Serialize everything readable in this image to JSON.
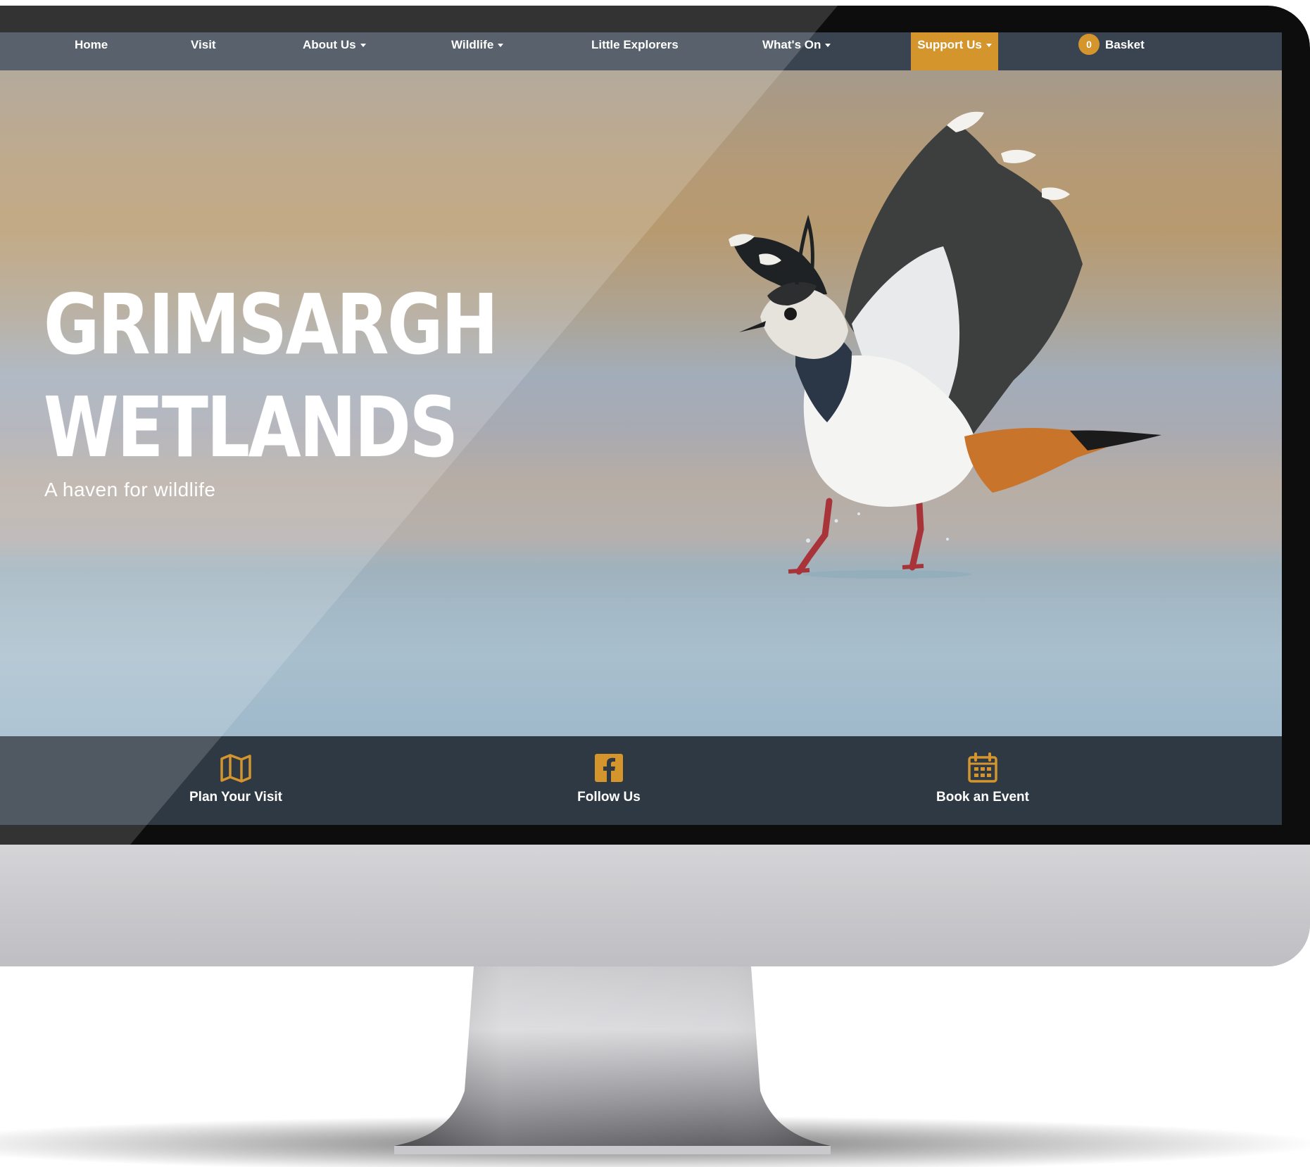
{
  "nav": {
    "home": "Home",
    "visit": "Visit",
    "about": "About Us",
    "wildlife": "Wildlife",
    "little_explorers": "Little Explorers",
    "whats_on": "What's On",
    "support": "Support Us",
    "basket_count": "0",
    "basket": "Basket"
  },
  "hero": {
    "title_line1": "GRIMSARGH",
    "title_line2": "WETLANDS",
    "subtitle": "A haven for wildlife"
  },
  "quick_links": {
    "plan": "Plan Your Visit",
    "follow": "Follow Us",
    "book": "Book an Event"
  },
  "colors": {
    "accent": "#d3952c",
    "nav_bg": "#3a4450",
    "footer_bg": "#2f3944"
  },
  "icons": {
    "plan": "map-icon",
    "follow": "facebook-icon",
    "book": "calendar-icon"
  }
}
